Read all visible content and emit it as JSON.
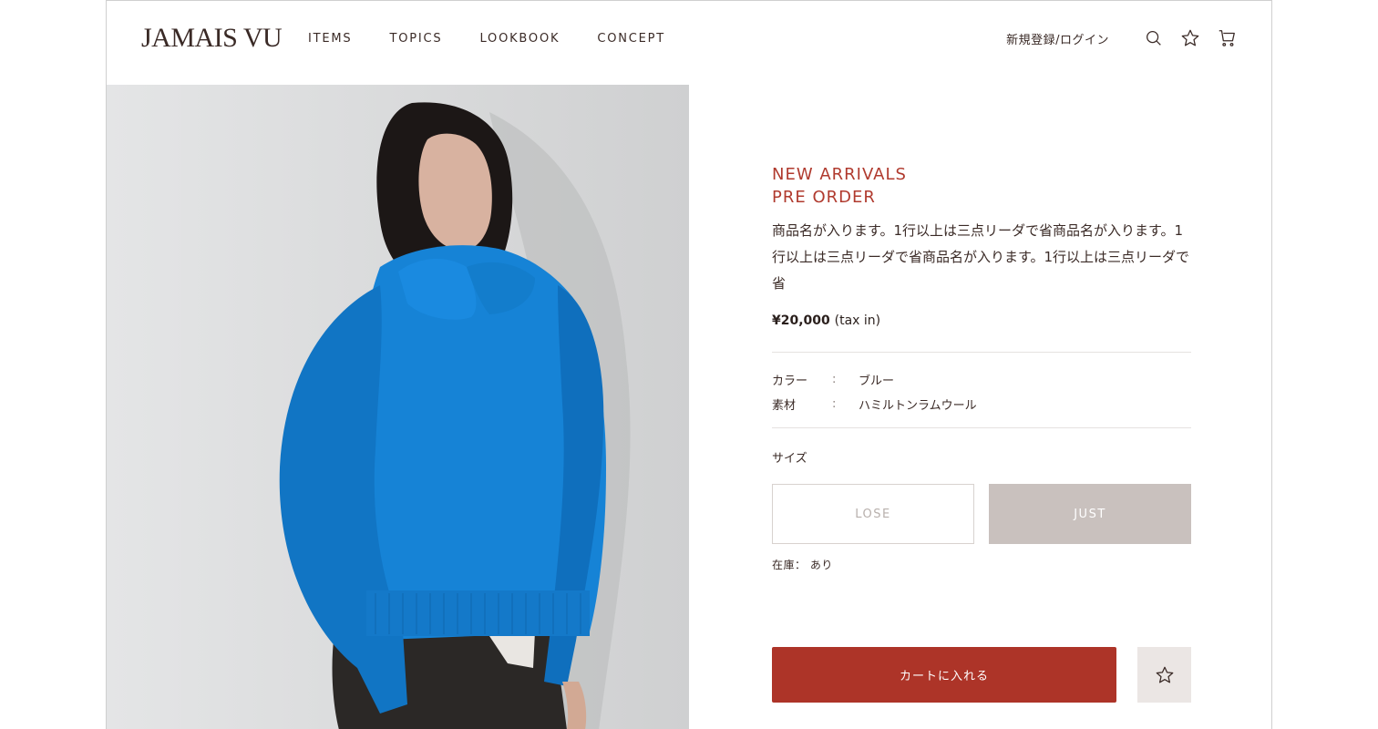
{
  "brand": {
    "logo_text": "JAMAIS VU"
  },
  "nav": {
    "items": [
      {
        "label": "ITEMS"
      },
      {
        "label": "TOPICS"
      },
      {
        "label": "LOOKBOOK"
      },
      {
        "label": "CONCEPT"
      }
    ]
  },
  "header": {
    "login_label": "新規登録/ログイン",
    "icons": [
      "search-icon",
      "star-icon",
      "cart-icon"
    ]
  },
  "product": {
    "image_alt": "product photo",
    "tag_line1": "NEW ARRIVALS",
    "tag_line2": "PRE ORDER",
    "name": "商品名が入ります。1行以上は三点リーダで省商品名が入ります。1行以上は三点リーダで省商品名が入ります。1行以上は三点リーダで省",
    "price": "¥20,000",
    "tax_note": "(tax in)",
    "specs": [
      {
        "label": "カラー",
        "sep": ":",
        "value": "ブルー"
      },
      {
        "label": "素材",
        "sep": ":",
        "value": "ハミルトンラムウール"
      }
    ],
    "size_label": "サイズ",
    "sizes": [
      {
        "label": "LOSE",
        "state": "unavailable"
      },
      {
        "label": "JUST",
        "state": "selected"
      }
    ],
    "stock": "在庫： あり"
  },
  "actions": {
    "cart_label": "カートに入れる",
    "favorite_icon": "star-icon"
  },
  "colors": {
    "accent": "#ad3428",
    "tag": "#b03a2e",
    "text": "#3a2a26",
    "size_selected": "#c9c1be",
    "fav_bg": "#ebe6e4",
    "sweater": "#1683d6"
  }
}
